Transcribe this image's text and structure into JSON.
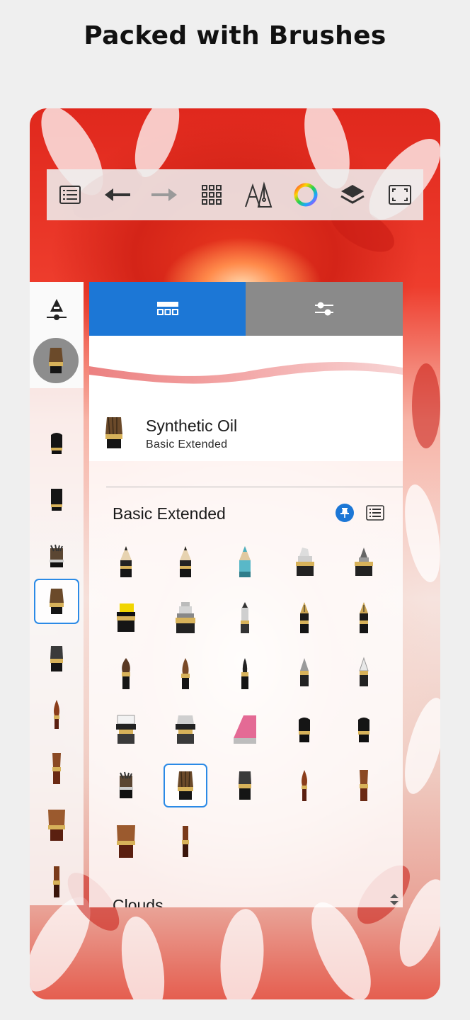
{
  "headline": "Packed with Brushes",
  "toolbar": {
    "items": [
      {
        "name": "list-icon"
      },
      {
        "name": "undo-icon"
      },
      {
        "name": "redo-icon"
      },
      {
        "name": "grid-icon"
      },
      {
        "name": "pencil-pen-icon"
      },
      {
        "name": "color-wheel-icon"
      },
      {
        "name": "layers-icon"
      },
      {
        "name": "fullscreen-icon"
      }
    ]
  },
  "panel": {
    "tabs": [
      {
        "icon": "brush-library-icon",
        "active": true
      },
      {
        "icon": "brush-settings-icon",
        "active": false
      }
    ],
    "selected_brush": {
      "name": "Synthetic Oil",
      "set": "Basic Extended"
    },
    "library": {
      "title": "Basic Extended",
      "brushes": [
        "pencil",
        "pencil",
        "colored-pencil",
        "chisel-marker",
        "brush-pen",
        "highlighter",
        "ink-pen",
        "ballpoint",
        "fountain-pen",
        "fountain-pen",
        "round-brush",
        "ink-brush",
        "fine-liner",
        "airbrush",
        "soft-brush",
        "eraser-hard",
        "eraser-soft",
        "eraser",
        "flat-marker",
        "flat-marker",
        "flat-brush",
        "synthetic-oil",
        "filbert-brush",
        "round-paint-brush",
        "flat-paint-brush",
        "wide-flat-brush",
        "thin-flat-brush"
      ],
      "selected_index": 21
    },
    "next_section": "Clouds"
  },
  "colors": {
    "accent": "#1c77d6",
    "selection": "#2b8ae6",
    "flower_red": "#e0281d"
  }
}
